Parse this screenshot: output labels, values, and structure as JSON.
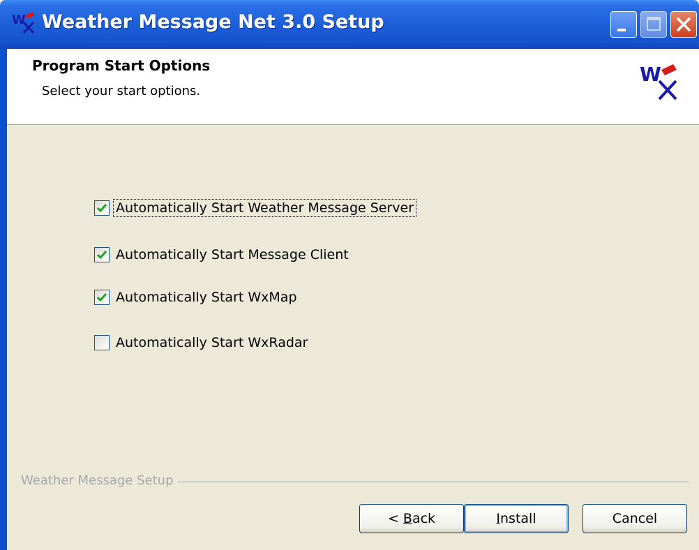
{
  "window": {
    "title": "Weather Message Net 3.0 Setup",
    "title_bar_color": "#1d5fd9",
    "controls": [
      "minimize-icon",
      "maximize-icon",
      "close-icon"
    ]
  },
  "header": {
    "title": "Program Start Options",
    "subtitle": "Select your start options.",
    "logo_text": "WX"
  },
  "options": [
    {
      "label": "Automatically Start Weather Message Server",
      "checked": true,
      "focused": true
    },
    {
      "label": "Automatically Start Message Client",
      "checked": true,
      "focused": false
    },
    {
      "label": "Automatically Start WxMap",
      "checked": true,
      "focused": false
    },
    {
      "label": "Automatically Start WxRadar",
      "checked": false,
      "focused": false
    }
  ],
  "group_label": "Weather Message Setup",
  "buttons": {
    "back": {
      "prefix": "< ",
      "accel": "B",
      "rest": "ack"
    },
    "install": {
      "accel": "I",
      "rest": "nstall"
    },
    "cancel": "Cancel"
  },
  "colors": {
    "check_green": "#21a121",
    "dialog_bg": "#ece9d8"
  }
}
